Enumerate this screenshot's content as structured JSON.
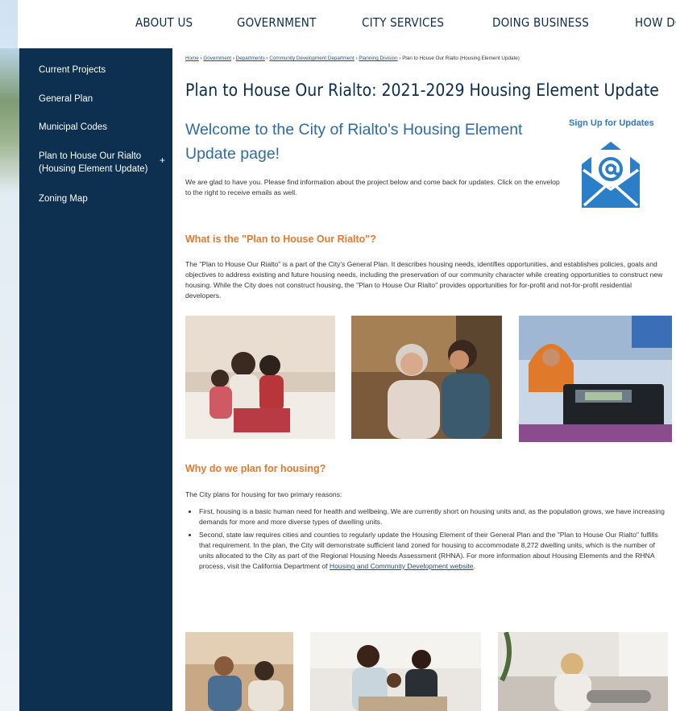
{
  "topnav": {
    "items": [
      "ABOUT US",
      "GOVERNMENT",
      "CITY SERVICES",
      "DOING BUSINESS",
      "HOW DO"
    ]
  },
  "sidebar": {
    "items": [
      {
        "label": "Current Projects"
      },
      {
        "label": "General Plan"
      },
      {
        "label": "Municipal Codes"
      },
      {
        "label": "Plan to House Our Rialto (Housing Element Update)",
        "expand": "+"
      },
      {
        "label": "Zoning Map"
      }
    ]
  },
  "breadcrumb": {
    "items": [
      "Home",
      "Government",
      "Departments",
      "Community Development Department",
      "Planning Division"
    ],
    "separator": "›",
    "current": "Plan to House Our Rialto (Housing Element Update)"
  },
  "main": {
    "title": "Plan to House Our Rialto: 2021-2029 Housing Element Update",
    "welcome": "Welcome to the City of Rialto's Housing Element Update page!",
    "signup": "Sign Up for Updates",
    "intro": "We are glad to have you. Please find information about the project below and come back for updates. Click on the envelop to the right to receive emails as well.",
    "section1_heading": "What is the \"Plan to House Our Rialto\"?",
    "section1_body": "The \"Plan to House Our Rialto\" is a part of the City's General Plan. It describes housing needs, identifies opportunities, and establishes policies, goals and objectives to address existing and future housing needs, including the preservation of our community character while creating opportunities to construct new housing. While the City does not construct housing, the \"Plan to House Our Rialto\" provides opportunities for for-profit and not-for-profit residential developers.",
    "section2_heading": "Why do we plan for housing?",
    "section2_intro": "The City plans for housing for two primary reasons:",
    "reason1": "First, housing is a basic human need for health and wellbeing. We are currently short on housing units and, as the population grows, we have increasing demands for more and more diverse types of dwelling units.",
    "reason2_text": "Second, state law requires cities and counties to regularly update the Housing Element of their General Plan and the \"Plan to House Our Rialto\" fulfills that requirement. In the plan, the City will demonstrate sufficient land zoned for housing to accommodate 8,272 dwelling units, which is the number of units allocated to the City as part of the Regional Housing Needs Assessment (RHNA). For more information about Housing Elements and the RHNA process, visit the California Department of ",
    "reason2_link": "Housing and Community Development website",
    "reason2_end": "."
  },
  "colors": {
    "navy": "#0d3050",
    "heading_orange": "#e07a2e",
    "welcome_blue": "#2e6aa6",
    "envelope_blue": "#2b7fc8"
  },
  "icons": [
    "envelope-at-icon"
  ]
}
